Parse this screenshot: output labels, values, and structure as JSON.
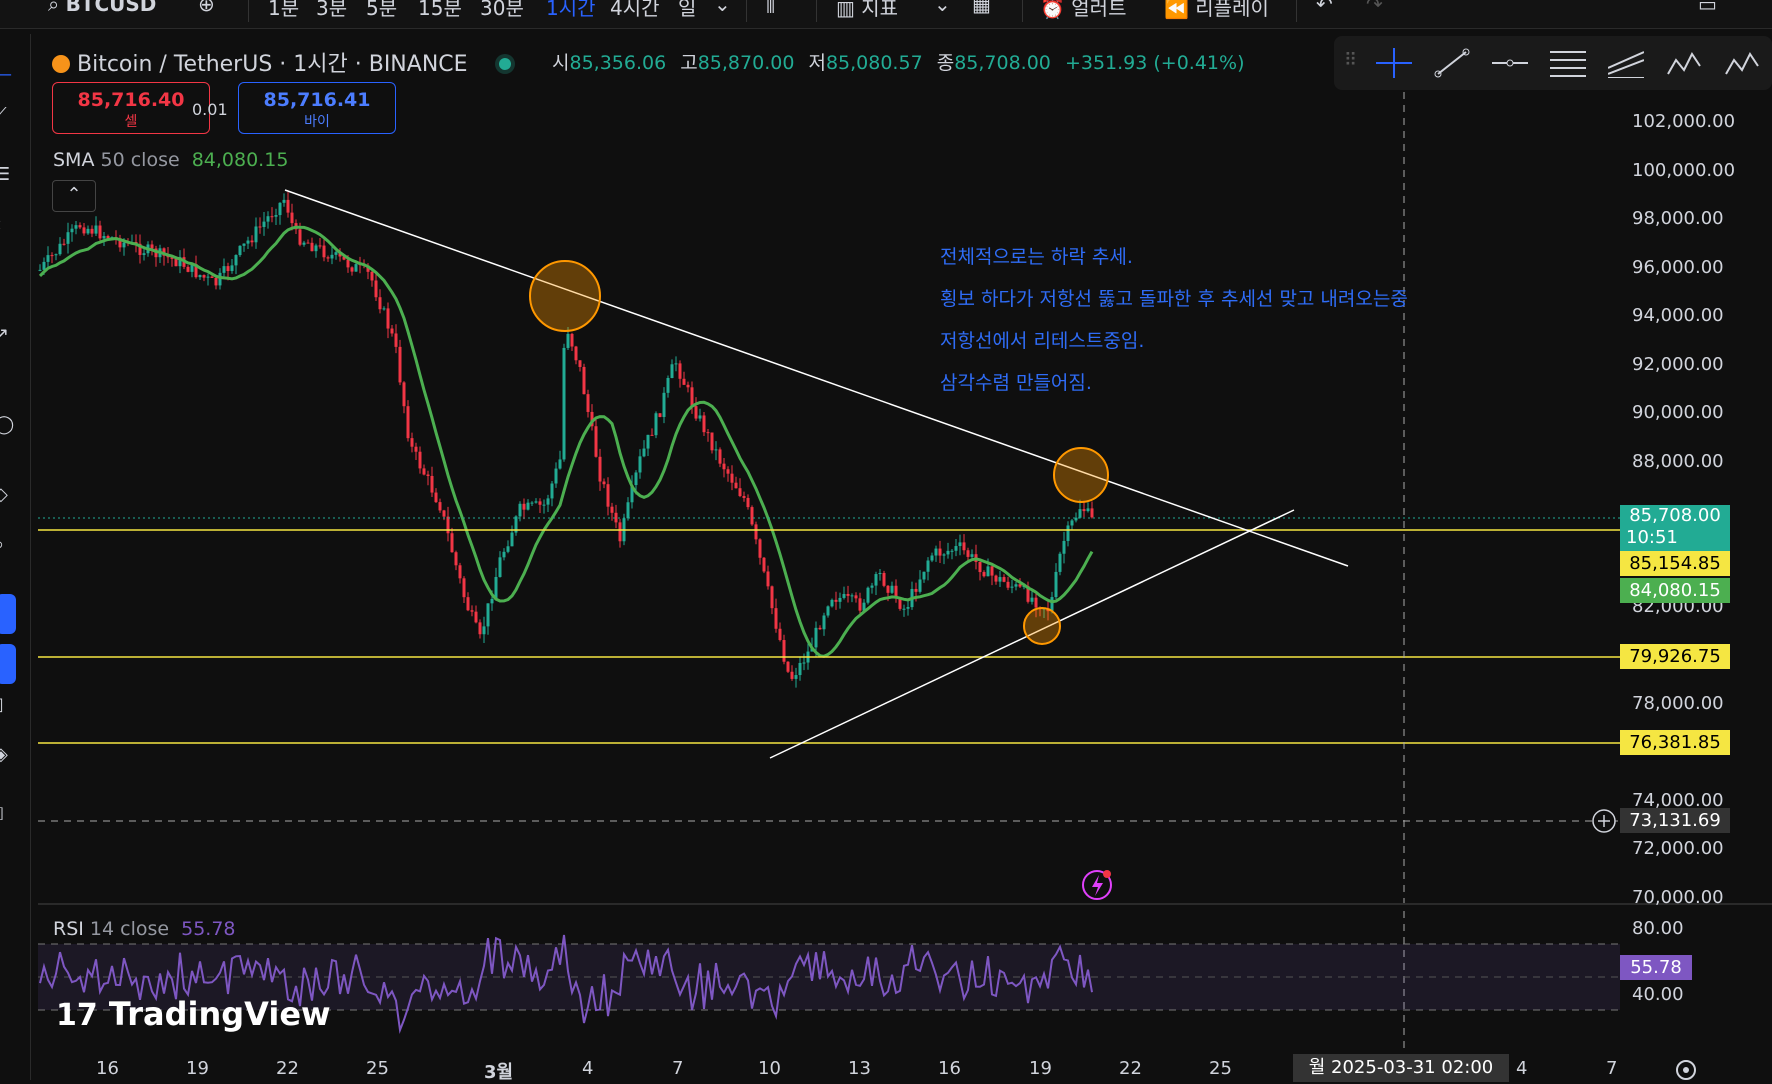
{
  "toolbar": {
    "symbol": "BTCUSD",
    "intervals": [
      "1분",
      "3분",
      "5분",
      "15분",
      "30분",
      "1시간",
      "4시간",
      "일"
    ],
    "active_interval": "1시간",
    "indicators_label": "지표",
    "alert_label": "얼러트",
    "replay_label": "리플레이"
  },
  "header": {
    "title": "Bitcoin / TetherUS · 1시간 · BINANCE",
    "ohlc": [
      {
        "label": "시",
        "value": "85,356.06"
      },
      {
        "label": "고",
        "value": "85,870.00"
      },
      {
        "label": "저",
        "value": "85,080.57"
      },
      {
        "label": "종",
        "value": "85,708.00"
      }
    ],
    "change": "+351.93 (+0.41%)"
  },
  "trade": {
    "sell_price": "85,716.40",
    "sell_label": "셀",
    "spread": "0.01",
    "buy_price": "85,716.41",
    "buy_label": "바이"
  },
  "sma": {
    "name": "SMA",
    "params": "50 close",
    "value": "84,080.15"
  },
  "annotations": [
    "전체적으로는 하락 추세.",
    "횡보 하다가 저항선 뚫고 돌파한 후 추세선 맞고 내려오는중",
    "저항선에서 리테스트중임.",
    "삼각수렴 만들어짐."
  ],
  "price_axis": {
    "labels": [
      "102,000.00",
      "100,000.00",
      "98,000.00",
      "96,000.00",
      "94,000.00",
      "92,000.00",
      "90,000.00",
      "88,000.00",
      "82,000.00",
      "78,000.00",
      "74,000.00",
      "72,000.00",
      "70,000.00"
    ],
    "tags": [
      {
        "price": "85,708.00",
        "sub": "10:51",
        "color": "#22ab94"
      },
      {
        "price": "85,154.85",
        "color": "#f5e642"
      },
      {
        "price": "84,080.15",
        "color": "#4caf50"
      },
      {
        "price": "79,926.75",
        "color": "#f5e642"
      },
      {
        "price": "76,381.85",
        "color": "#f5e642"
      }
    ],
    "crosshair_price": "73,131.69"
  },
  "rsi": {
    "name": "RSI",
    "params": "14 close",
    "value": "55.78",
    "levels": [
      "80.00",
      "40.00"
    ]
  },
  "time_axis": {
    "labels": [
      "16",
      "19",
      "22",
      "25",
      "3월",
      "4",
      "7",
      "10",
      "13",
      "16",
      "19",
      "22",
      "25",
      "4",
      "7"
    ],
    "crosshair_time": "월 2025-03-31   02:00"
  },
  "brand": "TradingView",
  "colors": {
    "up": "#22ab94",
    "down": "#f23645",
    "sma": "#4caf50",
    "hline": "#f5e642",
    "rsi": "#7e57c2",
    "annot": "#2f6cf6"
  }
}
